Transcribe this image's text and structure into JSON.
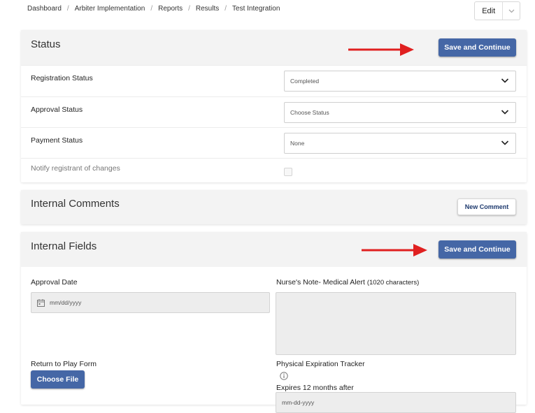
{
  "breadcrumb": {
    "items": [
      "Dashboard",
      "Arbiter Implementation",
      "Reports",
      "Results",
      "Test Integration"
    ],
    "separator": "/"
  },
  "edit": {
    "label": "Edit"
  },
  "status_card": {
    "title": "Status",
    "save_label": "Save and Continue",
    "rows": [
      {
        "label": "Registration Status",
        "value": "Completed"
      },
      {
        "label": "Approval Status",
        "value": "Choose Status"
      },
      {
        "label": "Payment Status",
        "value": "None"
      }
    ],
    "notify_label": "Notify registrant of changes"
  },
  "comments_card": {
    "title": "Internal Comments",
    "new_comment_label": "New Comment"
  },
  "fields_card": {
    "title": "Internal Fields",
    "save_label": "Save and Continue",
    "approval_date_label": "Approval Date",
    "approval_date_placeholder": "mm/dd/yyyy",
    "nurse_note_label": "Nurse's Note- Medical Alert",
    "nurse_note_hint": "(1020 characters)",
    "return_to_play_label": "Return to Play Form",
    "choose_file_label": "Choose File",
    "physical_tracker_label": "Physical Expiration Tracker",
    "expires_text": "Expires 12 months after",
    "expires_placeholder": "mm-dd-yyyy"
  },
  "colors": {
    "primary": "#4567a6",
    "arrow": "#e02020",
    "header_bg": "#f3f3f3"
  }
}
